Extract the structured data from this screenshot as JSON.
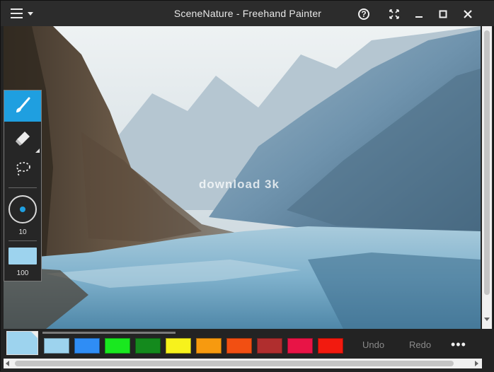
{
  "window": {
    "title": "SceneNature - Freehand Painter"
  },
  "titlebar": {
    "menu_icon": "hamburger-menu-icon",
    "help_icon": "help-icon",
    "fullscreen_icon": "fullscreen-icon",
    "minimize_icon": "minimize-icon",
    "maximize_icon": "maximize-icon",
    "close_icon": "close-icon"
  },
  "tools": {
    "brush_icon": "paintbrush-icon",
    "eraser_icon": "eraser-icon",
    "lasso_icon": "lasso-select-icon",
    "brush_size": "10",
    "opacity": "100",
    "current_color": "#9dd3ee",
    "active_color": "#1f9fe0"
  },
  "watermark": "download 3k",
  "palette": {
    "current_color": "#9dd3ee",
    "colors": [
      "#9dd3ee",
      "#2f8df5",
      "#19e81f",
      "#148a1d",
      "#f7f21c",
      "#f79a0f",
      "#f24f12",
      "#b02e2e",
      "#e81446",
      "#f21a0f"
    ]
  },
  "actions": {
    "undo": "Undo",
    "redo": "Redo",
    "more": "•••"
  }
}
